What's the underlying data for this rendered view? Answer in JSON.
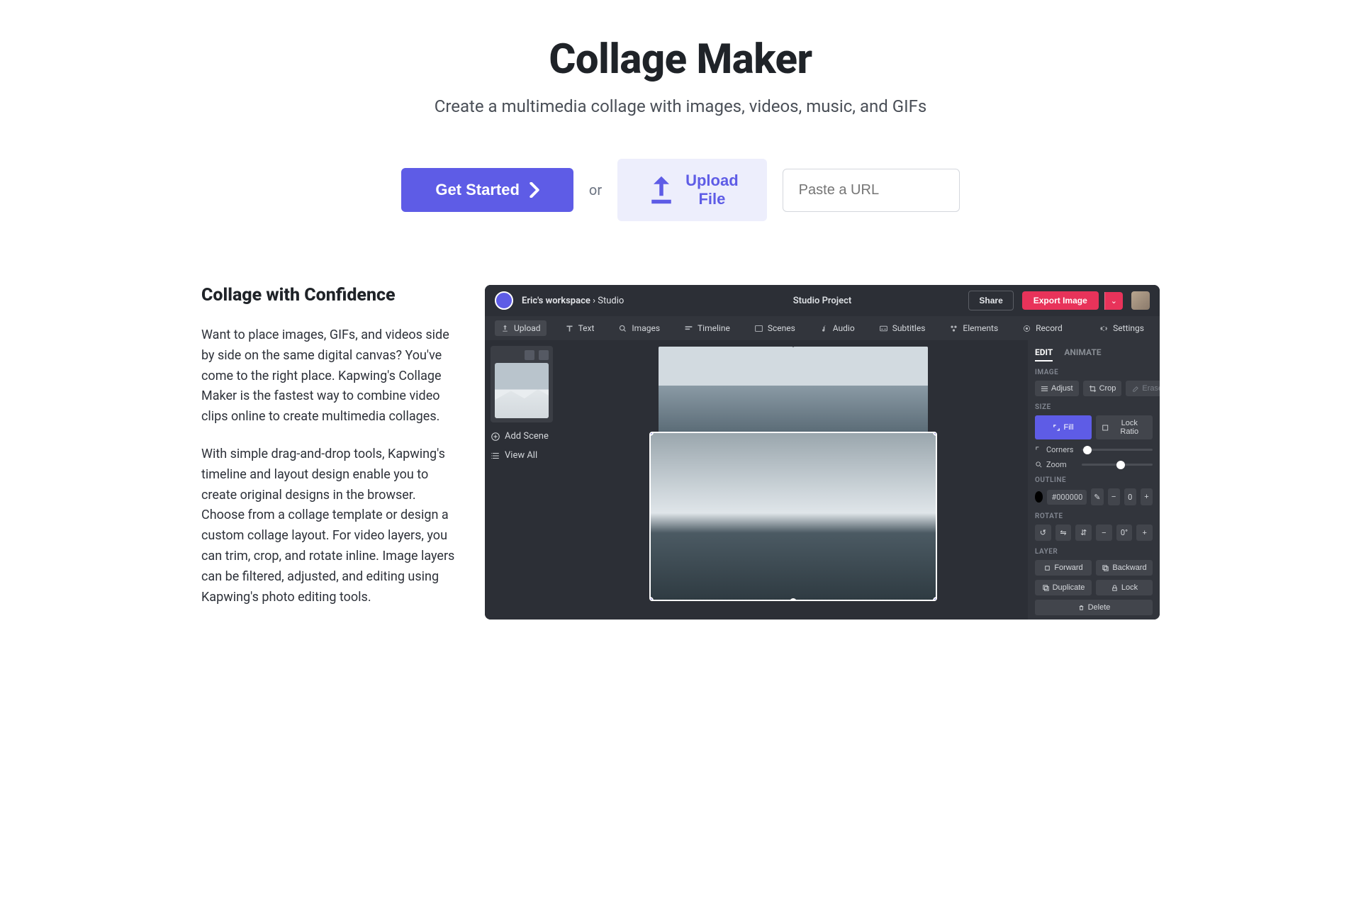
{
  "hero": {
    "title": "Collage Maker",
    "subtitle": "Create a multimedia collage with images, videos, music, and GIFs"
  },
  "cta": {
    "get_started": "Get Started",
    "or": "or",
    "upload": "Upload File",
    "url_placeholder": "Paste a URL"
  },
  "content": {
    "heading": "Collage with Confidence",
    "para1": "Want to place images, GIFs, and videos side by side on the same digital canvas? You've come to the right place. Kapwing's Collage Maker is the fastest way to combine video clips online to create multimedia collages.",
    "para2": "With simple drag-and-drop tools, Kapwing's timeline and layout design enable you to create original designs in the browser. Choose from a collage template or design a custom collage layout. For video layers, you can trim, crop, and rotate inline. Image layers can be filtered, adjusted, and editing using Kapwing's photo editing tools."
  },
  "editor": {
    "workspace": "Eric's workspace",
    "crumb_separator": "›",
    "crumb_page": "Studio",
    "project_title": "Studio Project",
    "share": "Share",
    "export": "Export Image",
    "toolbar": {
      "upload": "Upload",
      "text": "Text",
      "images": "Images",
      "timeline": "Timeline",
      "scenes": "Scenes",
      "audio": "Audio",
      "subtitles": "Subtitles",
      "elements": "Elements",
      "record": "Record",
      "settings": "Settings"
    },
    "scenes": {
      "add": "Add Scene",
      "view_all": "View All"
    },
    "panel": {
      "tab_edit": "EDIT",
      "tab_animate": "ANIMATE",
      "section_image": "IMAGE",
      "adjust": "Adjust",
      "crop": "Crop",
      "erase": "Erase",
      "section_size": "SIZE",
      "fill": "Fill",
      "lock_ratio": "Lock Ratio",
      "corners": "Corners",
      "zoom": "Zoom",
      "section_outline": "OUTLINE",
      "outline_hex": "#000000",
      "outline_width": "0",
      "section_rotate": "ROTATE",
      "rotate_deg": "0°",
      "section_layer": "LAYER",
      "forward": "Forward",
      "backward": "Backward",
      "duplicate": "Duplicate",
      "lock": "Lock",
      "delete": "Delete"
    }
  }
}
